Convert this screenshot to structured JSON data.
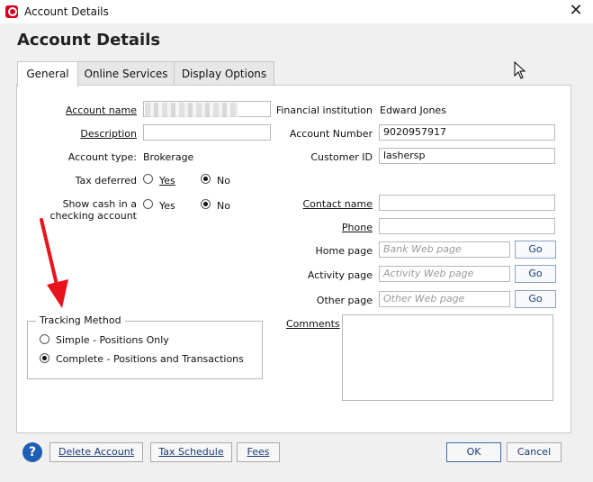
{
  "window": {
    "title": "Account Details",
    "close_glyph": "✕"
  },
  "heading": "Account Details",
  "tabs": [
    {
      "label": "General",
      "active": true
    },
    {
      "label": "Online Services",
      "active": false
    },
    {
      "label": "Display Options",
      "active": false
    }
  ],
  "form": {
    "account_name_label": "Account name",
    "account_name_value": "",
    "description_label": "Description",
    "description_value": "",
    "account_type_label": "Account type:",
    "account_type_value": "Brokerage",
    "tax_deferred_label": "Tax deferred",
    "show_cash_label_line1": "Show cash in a",
    "show_cash_label_line2": "checking account",
    "yes_label": "Yes",
    "no_label": "No",
    "tax_deferred_selected": "No",
    "show_cash_selected": "No",
    "financial_institution_label": "Financial institution",
    "financial_institution_value": "Edward Jones",
    "account_number_label": "Account Number",
    "account_number_value": "9020957917",
    "customer_id_label": "Customer ID",
    "customer_id_value": "lashersp",
    "contact_name_label": "Contact name",
    "contact_name_value": "",
    "phone_label": "Phone",
    "phone_value": "",
    "home_page_label": "Home page",
    "home_page_placeholder": "Bank Web page",
    "activity_page_label": "Activity page",
    "activity_page_placeholder": "Activity Web page",
    "other_page_label": "Other page",
    "other_page_placeholder": "Other Web page",
    "go_label": "Go",
    "comments_label": "Comments"
  },
  "tracking": {
    "legend": "Tracking Method",
    "options": [
      {
        "label": "Simple - Positions Only",
        "selected": false
      },
      {
        "label": "Complete - Positions and Transactions",
        "selected": true
      }
    ]
  },
  "footer": {
    "help_glyph": "?",
    "delete_account": "Delete Account",
    "tax_schedule": "Tax Schedule",
    "fees": "Fees",
    "ok": "OK",
    "cancel": "Cancel"
  },
  "colors": {
    "arrow": "#e8141c",
    "brand": "#d6001c",
    "help": "#1f5fb3"
  }
}
